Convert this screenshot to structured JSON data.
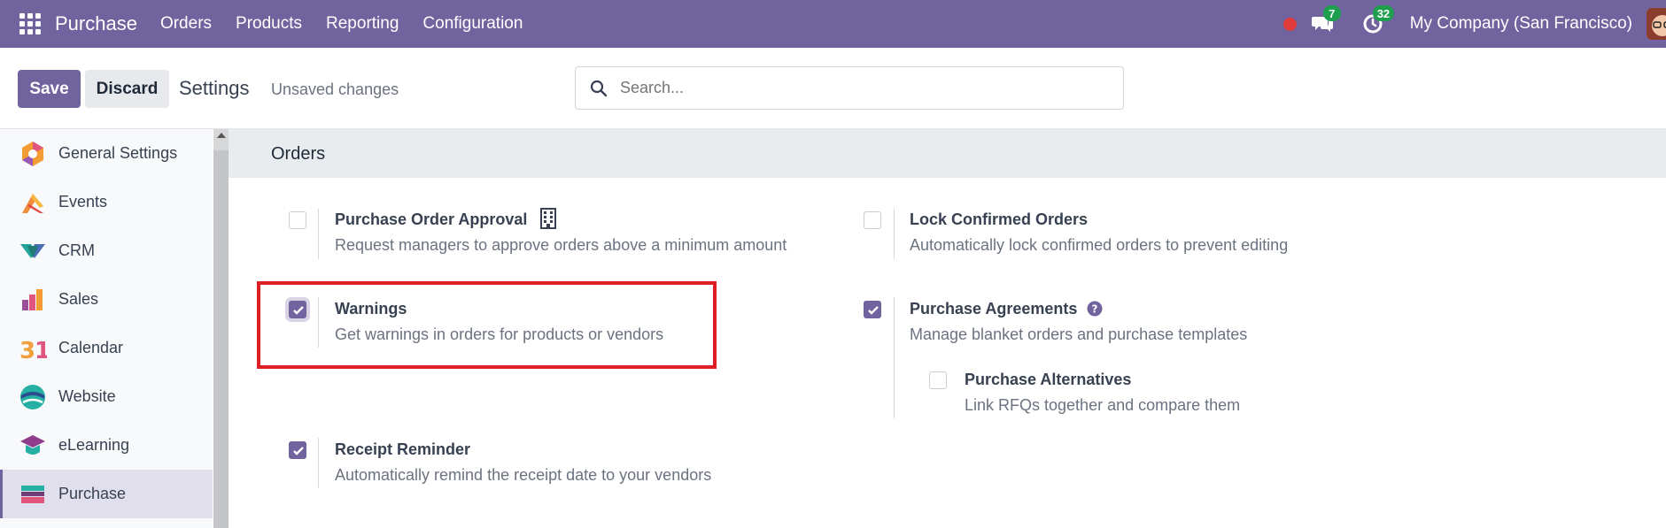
{
  "navbar": {
    "app_name": "Purchase",
    "menu": [
      "Orders",
      "Products",
      "Reporting",
      "Configuration"
    ],
    "messages_count": "7",
    "activities_count": "32",
    "company": "My Company (San Francisco)"
  },
  "control": {
    "save_label": "Save",
    "discard_label": "Discard",
    "title": "Settings",
    "status": "Unsaved changes",
    "search_placeholder": "Search..."
  },
  "sidebar": {
    "items": [
      {
        "label": "General Settings",
        "icon": "general-settings-icon"
      },
      {
        "label": "Events",
        "icon": "events-icon"
      },
      {
        "label": "CRM",
        "icon": "crm-icon"
      },
      {
        "label": "Sales",
        "icon": "sales-icon"
      },
      {
        "label": "Calendar",
        "icon": "calendar-icon"
      },
      {
        "label": "Website",
        "icon": "website-icon"
      },
      {
        "label": "eLearning",
        "icon": "elearning-icon"
      },
      {
        "label": "Purchase",
        "icon": "purchase-icon",
        "active": true
      }
    ]
  },
  "section": {
    "title": "Orders",
    "settings": {
      "approval": {
        "title": "Purchase Order Approval",
        "desc": "Request managers to approve orders above a minimum amount",
        "checked": false
      },
      "lock": {
        "title": "Lock Confirmed Orders",
        "desc": "Automatically lock confirmed orders to prevent editing",
        "checked": false
      },
      "warnings": {
        "title": "Warnings",
        "desc": "Get warnings in orders for products or vendors",
        "checked": true
      },
      "agreements": {
        "title": "Purchase Agreements",
        "desc": "Manage blanket orders and purchase templates",
        "checked": true
      },
      "alternatives": {
        "title": "Purchase Alternatives",
        "desc": "Link RFQs together and compare them",
        "checked": false
      },
      "reminder": {
        "title": "Receipt Reminder",
        "desc": "Automatically remind the receipt date to your vendors",
        "checked": true
      }
    }
  },
  "colors": {
    "brand": "#71639e",
    "highlight": "#dd1f26",
    "badge": "#1d9f4e"
  }
}
